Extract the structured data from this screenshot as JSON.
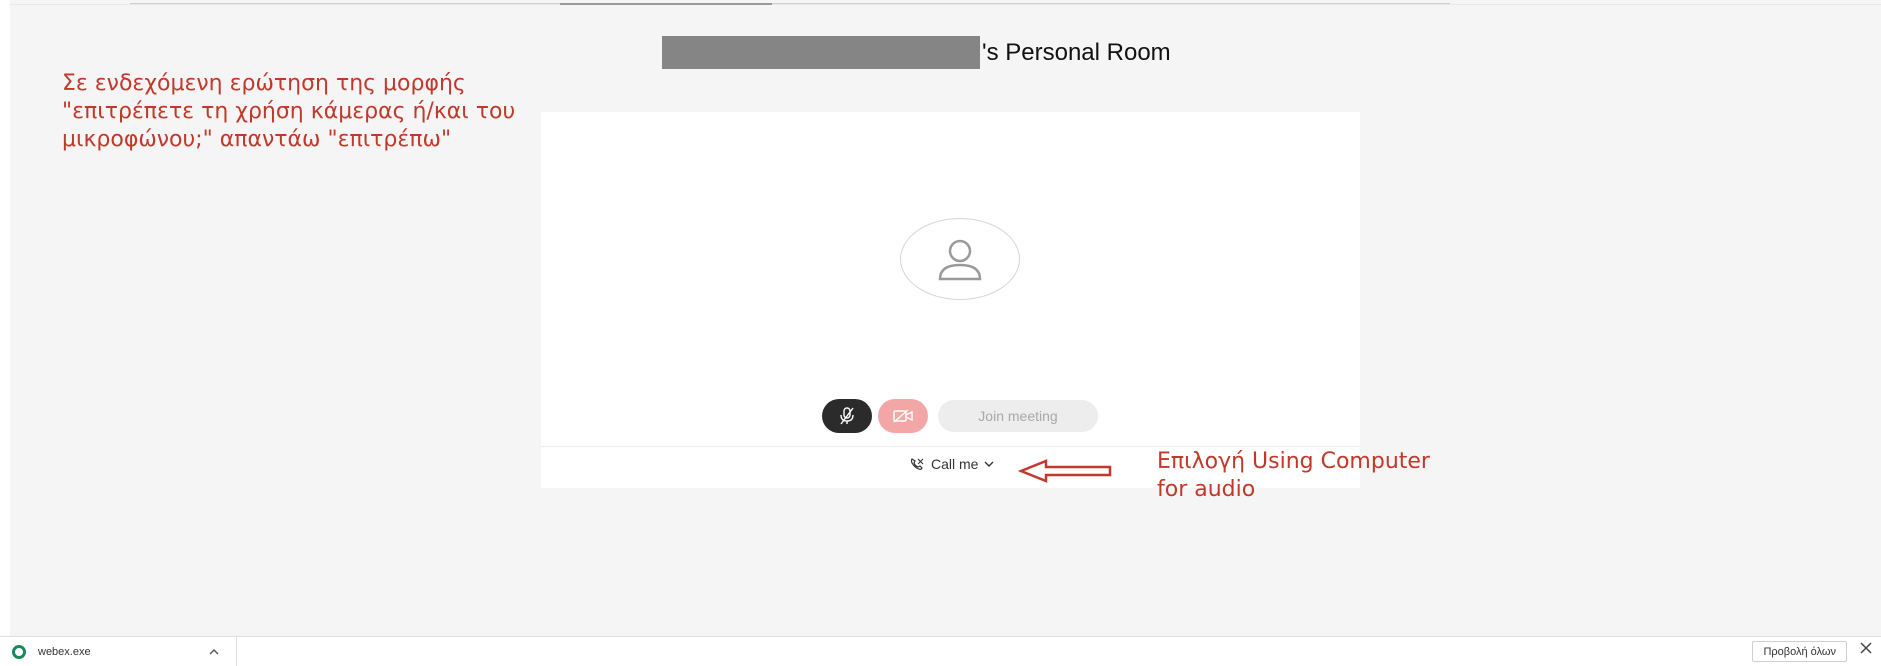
{
  "meeting": {
    "title_suffix": "'s Personal Room",
    "join_label": "Join meeting",
    "audio_option_label": "Call me"
  },
  "annotations": {
    "top_lines": [
      "Σε ενδεχόμενη ερώτηση της μορφής",
      "\"επιτρέπετε τη χρήση κάμερας ή/και του",
      "μικροφώνου;\" απαντάω \"επιτρέπω\""
    ],
    "right_lines": [
      "Επιλογή Using Computer",
      "for audio"
    ]
  },
  "download_bar": {
    "file_name": "webex.exe",
    "show_all_label": "Προβολή όλων"
  },
  "icons": {
    "avatar": "person-icon",
    "mute": "microphone-muted-icon",
    "video": "camera-off-icon",
    "audio": "phone-icon",
    "dropdown": "chevron-down-icon",
    "download": "webex-icon",
    "close": "close-icon"
  },
  "colors": {
    "annotation": "#c0392b",
    "mute_button": "#2b2b2b",
    "video_button": "#f3a6a6",
    "join_button": "#ededed"
  }
}
